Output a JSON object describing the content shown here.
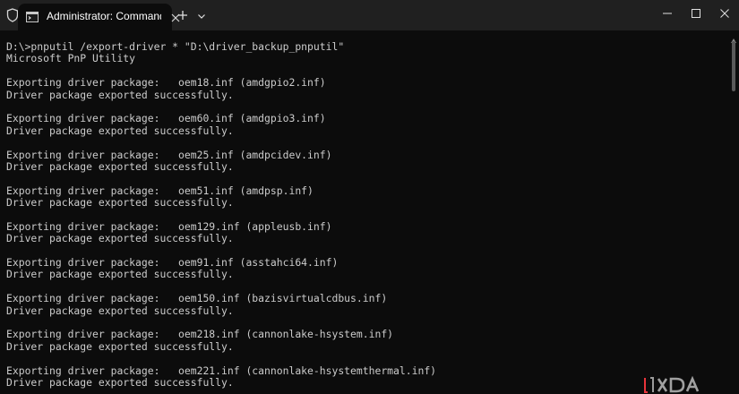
{
  "window": {
    "tab_title": "Administrator: Command Pro"
  },
  "icons": {
    "shield": "shield-icon",
    "cmd": "command-prompt-icon",
    "close_tab": "close-icon",
    "new_tab": "plus-icon",
    "dropdown": "chevron-down-icon",
    "minimize": "minimize-icon",
    "maximize": "maximize-icon",
    "close_window": "close-icon"
  },
  "colors": {
    "titlebar": "#202020",
    "terminal_bg": "#0c0c0c",
    "terminal_text": "#cccccc",
    "watermark_accent": "#e8343b"
  },
  "terminal": {
    "lines": [
      "D:\\>pnputil /export-driver * \"D:\\driver_backup_pnputil\"",
      "Microsoft PnP Utility",
      "",
      "Exporting driver package:   oem18.inf (amdgpio2.inf)",
      "Driver package exported successfully.",
      "",
      "Exporting driver package:   oem60.inf (amdgpio3.inf)",
      "Driver package exported successfully.",
      "",
      "Exporting driver package:   oem25.inf (amdpcidev.inf)",
      "Driver package exported successfully.",
      "",
      "Exporting driver package:   oem51.inf (amdpsp.inf)",
      "Driver package exported successfully.",
      "",
      "Exporting driver package:   oem129.inf (appleusb.inf)",
      "Driver package exported successfully.",
      "",
      "Exporting driver package:   oem91.inf (asstahci64.inf)",
      "Driver package exported successfully.",
      "",
      "Exporting driver package:   oem150.inf (bazisvirtualcdbus.inf)",
      "Driver package exported successfully.",
      "",
      "Exporting driver package:   oem218.inf (cannonlake-hsystem.inf)",
      "Driver package exported successfully.",
      "",
      "Exporting driver package:   oem221.inf (cannonlake-hsystemthermal.inf)",
      "Driver package exported successfully."
    ]
  },
  "watermark": {
    "text": "XDA"
  }
}
